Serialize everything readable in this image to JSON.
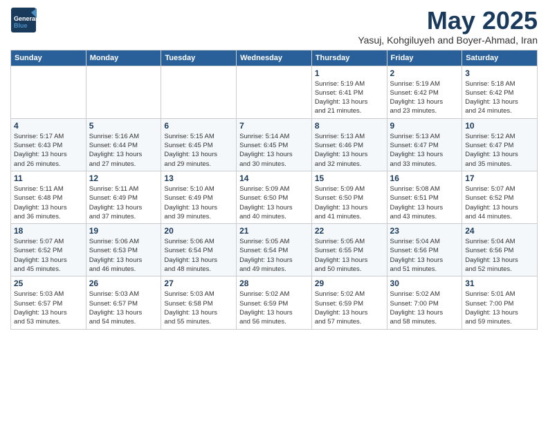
{
  "logo": {
    "general": "General",
    "blue": "Blue"
  },
  "header": {
    "month": "May 2025",
    "location": "Yasuj, Kohgiluyeh and Boyer-Ahmad, Iran"
  },
  "weekdays": [
    "Sunday",
    "Monday",
    "Tuesday",
    "Wednesday",
    "Thursday",
    "Friday",
    "Saturday"
  ],
  "weeks": [
    [
      {
        "day": "",
        "info": ""
      },
      {
        "day": "",
        "info": ""
      },
      {
        "day": "",
        "info": ""
      },
      {
        "day": "",
        "info": ""
      },
      {
        "day": "1",
        "info": "Sunrise: 5:19 AM\nSunset: 6:41 PM\nDaylight: 13 hours\nand 21 minutes."
      },
      {
        "day": "2",
        "info": "Sunrise: 5:19 AM\nSunset: 6:42 PM\nDaylight: 13 hours\nand 23 minutes."
      },
      {
        "day": "3",
        "info": "Sunrise: 5:18 AM\nSunset: 6:42 PM\nDaylight: 13 hours\nand 24 minutes."
      }
    ],
    [
      {
        "day": "4",
        "info": "Sunrise: 5:17 AM\nSunset: 6:43 PM\nDaylight: 13 hours\nand 26 minutes."
      },
      {
        "day": "5",
        "info": "Sunrise: 5:16 AM\nSunset: 6:44 PM\nDaylight: 13 hours\nand 27 minutes."
      },
      {
        "day": "6",
        "info": "Sunrise: 5:15 AM\nSunset: 6:45 PM\nDaylight: 13 hours\nand 29 minutes."
      },
      {
        "day": "7",
        "info": "Sunrise: 5:14 AM\nSunset: 6:45 PM\nDaylight: 13 hours\nand 30 minutes."
      },
      {
        "day": "8",
        "info": "Sunrise: 5:13 AM\nSunset: 6:46 PM\nDaylight: 13 hours\nand 32 minutes."
      },
      {
        "day": "9",
        "info": "Sunrise: 5:13 AM\nSunset: 6:47 PM\nDaylight: 13 hours\nand 33 minutes."
      },
      {
        "day": "10",
        "info": "Sunrise: 5:12 AM\nSunset: 6:47 PM\nDaylight: 13 hours\nand 35 minutes."
      }
    ],
    [
      {
        "day": "11",
        "info": "Sunrise: 5:11 AM\nSunset: 6:48 PM\nDaylight: 13 hours\nand 36 minutes."
      },
      {
        "day": "12",
        "info": "Sunrise: 5:11 AM\nSunset: 6:49 PM\nDaylight: 13 hours\nand 37 minutes."
      },
      {
        "day": "13",
        "info": "Sunrise: 5:10 AM\nSunset: 6:49 PM\nDaylight: 13 hours\nand 39 minutes."
      },
      {
        "day": "14",
        "info": "Sunrise: 5:09 AM\nSunset: 6:50 PM\nDaylight: 13 hours\nand 40 minutes."
      },
      {
        "day": "15",
        "info": "Sunrise: 5:09 AM\nSunset: 6:50 PM\nDaylight: 13 hours\nand 41 minutes."
      },
      {
        "day": "16",
        "info": "Sunrise: 5:08 AM\nSunset: 6:51 PM\nDaylight: 13 hours\nand 43 minutes."
      },
      {
        "day": "17",
        "info": "Sunrise: 5:07 AM\nSunset: 6:52 PM\nDaylight: 13 hours\nand 44 minutes."
      }
    ],
    [
      {
        "day": "18",
        "info": "Sunrise: 5:07 AM\nSunset: 6:52 PM\nDaylight: 13 hours\nand 45 minutes."
      },
      {
        "day": "19",
        "info": "Sunrise: 5:06 AM\nSunset: 6:53 PM\nDaylight: 13 hours\nand 46 minutes."
      },
      {
        "day": "20",
        "info": "Sunrise: 5:06 AM\nSunset: 6:54 PM\nDaylight: 13 hours\nand 48 minutes."
      },
      {
        "day": "21",
        "info": "Sunrise: 5:05 AM\nSunset: 6:54 PM\nDaylight: 13 hours\nand 49 minutes."
      },
      {
        "day": "22",
        "info": "Sunrise: 5:05 AM\nSunset: 6:55 PM\nDaylight: 13 hours\nand 50 minutes."
      },
      {
        "day": "23",
        "info": "Sunrise: 5:04 AM\nSunset: 6:56 PM\nDaylight: 13 hours\nand 51 minutes."
      },
      {
        "day": "24",
        "info": "Sunrise: 5:04 AM\nSunset: 6:56 PM\nDaylight: 13 hours\nand 52 minutes."
      }
    ],
    [
      {
        "day": "25",
        "info": "Sunrise: 5:03 AM\nSunset: 6:57 PM\nDaylight: 13 hours\nand 53 minutes."
      },
      {
        "day": "26",
        "info": "Sunrise: 5:03 AM\nSunset: 6:57 PM\nDaylight: 13 hours\nand 54 minutes."
      },
      {
        "day": "27",
        "info": "Sunrise: 5:03 AM\nSunset: 6:58 PM\nDaylight: 13 hours\nand 55 minutes."
      },
      {
        "day": "28",
        "info": "Sunrise: 5:02 AM\nSunset: 6:59 PM\nDaylight: 13 hours\nand 56 minutes."
      },
      {
        "day": "29",
        "info": "Sunrise: 5:02 AM\nSunset: 6:59 PM\nDaylight: 13 hours\nand 57 minutes."
      },
      {
        "day": "30",
        "info": "Sunrise: 5:02 AM\nSunset: 7:00 PM\nDaylight: 13 hours\nand 58 minutes."
      },
      {
        "day": "31",
        "info": "Sunrise: 5:01 AM\nSunset: 7:00 PM\nDaylight: 13 hours\nand 59 minutes."
      }
    ]
  ]
}
